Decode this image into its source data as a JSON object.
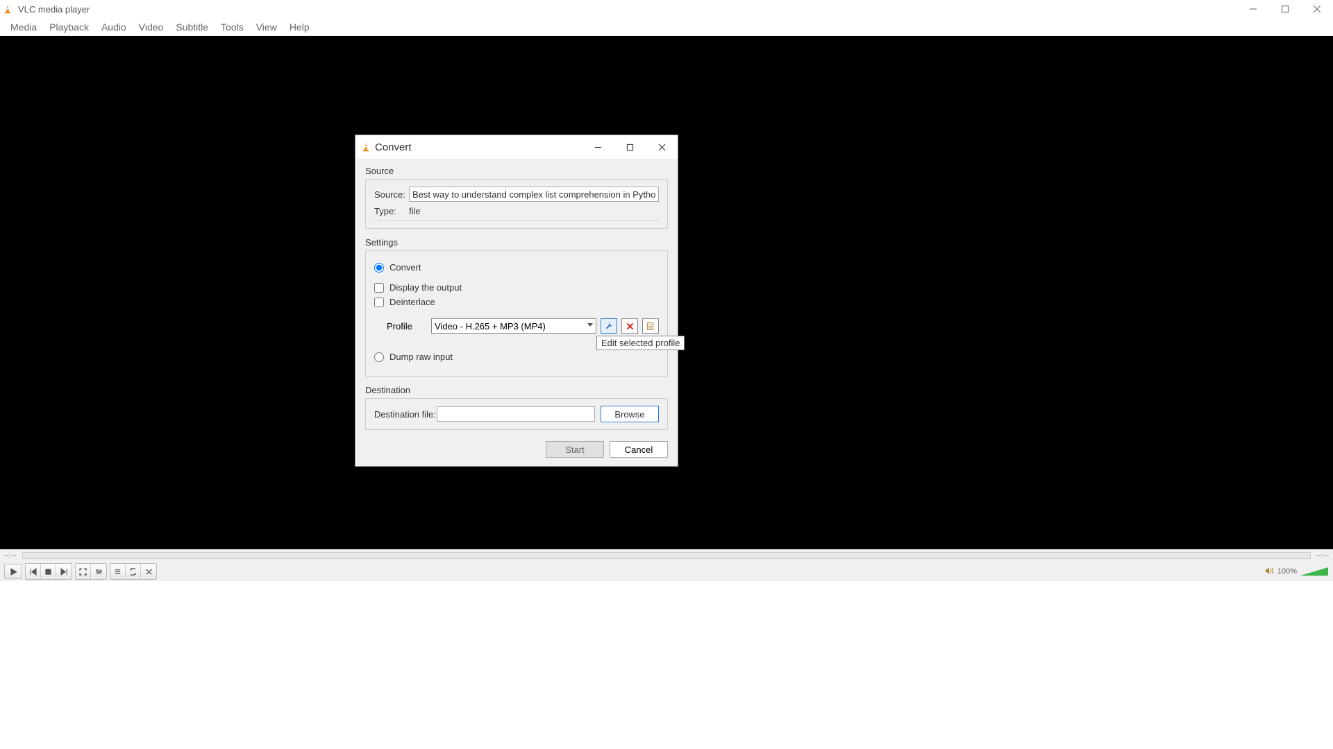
{
  "window": {
    "title": "VLC media player"
  },
  "menu": {
    "items": [
      "Media",
      "Playback",
      "Audio",
      "Video",
      "Subtitle",
      "Tools",
      "View",
      "Help"
    ]
  },
  "dialog": {
    "title": "Convert",
    "source": {
      "group": "Source",
      "source_label": "Source:",
      "source_value": "Best way to understand complex list comprehension in Python.wmv",
      "type_label": "Type:",
      "type_value": "file"
    },
    "settings": {
      "group": "Settings",
      "convert": "Convert",
      "display_output": "Display the output",
      "deinterlace": "Deinterlace",
      "profile_label": "Profile",
      "profile_selected": "Video - H.265 + MP3 (MP4)",
      "dump_raw": "Dump raw input"
    },
    "tooltip": "Edit selected profile",
    "destination": {
      "group": "Destination",
      "file_label": "Destination file:",
      "file_value": "",
      "browse": "Browse"
    },
    "buttons": {
      "start": "Start",
      "cancel": "Cancel"
    }
  },
  "player": {
    "time_left": "--:--",
    "time_right": "--:--",
    "volume_pct": "100%"
  }
}
